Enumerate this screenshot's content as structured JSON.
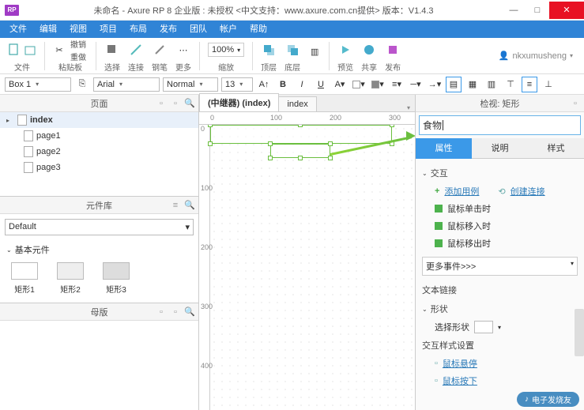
{
  "window": {
    "app_badge": "RP",
    "title": "未命名 - Axure RP 8 企业版 : 未授权   <中文支持：www.axure.com.cn提供> 版本：V1.4.3",
    "min": "—",
    "max": "□",
    "close": "✕"
  },
  "menu": [
    "文件",
    "编辑",
    "视图",
    "项目",
    "布局",
    "发布",
    "团队",
    "帐户",
    "帮助"
  ],
  "toolbar1": {
    "group_file": "文件",
    "group_paste": "粘贴板",
    "undo": "撤销",
    "redo": "重做",
    "select": "选择",
    "connect": "连接",
    "pen": "钢笔",
    "more": "更多",
    "zoom_value": "100%",
    "zoom_label": "缩放",
    "top": "顶层",
    "bottom": "底层",
    "preview": "预览",
    "share": "共享",
    "publish": "发布",
    "user": "nkxumusheng"
  },
  "toolbar2": {
    "widget_name": "Box 1",
    "font": "Arial",
    "weight": "Normal",
    "size": "13"
  },
  "panels": {
    "pages_title": "页面",
    "lib_title": "元件库",
    "masters_title": "母版",
    "inspector_title": "检视: 矩形"
  },
  "pages": {
    "root": "index",
    "children": [
      "page1",
      "page2",
      "page3"
    ]
  },
  "library": {
    "set": "Default",
    "section": "基本元件",
    "shapes": [
      "矩形1",
      "矩形2",
      "矩形3"
    ]
  },
  "canvas": {
    "tab_active": "(中继器) (index)",
    "tab_other": "index",
    "ruler_h": [
      "0",
      "100",
      "200",
      "300"
    ],
    "ruler_v": [
      "0",
      "100",
      "200",
      "300",
      "400"
    ]
  },
  "inspector": {
    "name_value": "食物",
    "tabs": [
      "属性",
      "说明",
      "样式"
    ],
    "sec_interact": "交互",
    "add_case": "添加用例",
    "create_link": "创建连接",
    "events": [
      "鼠标单击时",
      "鼠标移入时",
      "鼠标移出时"
    ],
    "more_events": "更多事件>>>",
    "sec_textlink": "文本链接",
    "sec_shape": "形状",
    "select_shape": "选择形状",
    "sec_ix_style": "交互样式设置",
    "ix_hover": "鼠标悬停",
    "ix_down": "鼠标按下"
  },
  "watermark": "电子发烧友"
}
